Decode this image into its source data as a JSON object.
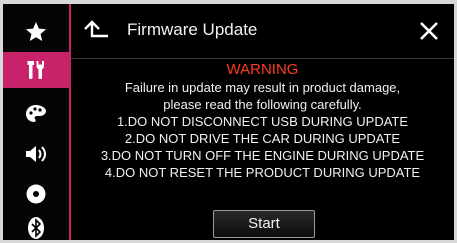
{
  "header": {
    "title": "Firmware Update",
    "back_icon": "back-arrow-icon",
    "close_icon": "close-icon"
  },
  "sidebar": {
    "items": [
      {
        "icon": "star-icon",
        "active": false
      },
      {
        "icon": "tools-icon",
        "active": true
      },
      {
        "icon": "palette-icon",
        "active": false
      },
      {
        "icon": "speaker-icon",
        "active": false
      },
      {
        "icon": "disc-icon",
        "active": false
      },
      {
        "icon": "bluetooth-icon",
        "active": false
      }
    ]
  },
  "message": {
    "warning_title": "WARNING",
    "lines": [
      "Failure in update may result in product damage,",
      "please read the following carefully.",
      "1.DO NOT DISCONNECT USB DURING UPDATE",
      "2.DO NOT DRIVE THE CAR DURING UPDATE",
      "3.DO NOT TURN OFF THE ENGINE DURING UPDATE",
      "4.DO NOT RESET THE PRODUCT DURING UPDATE"
    ]
  },
  "actions": {
    "start_label": "Start"
  },
  "colors": {
    "accent": "#c8226b",
    "warning": "#ff3a1e",
    "text": "#f2f2f2",
    "background": "#000000"
  }
}
